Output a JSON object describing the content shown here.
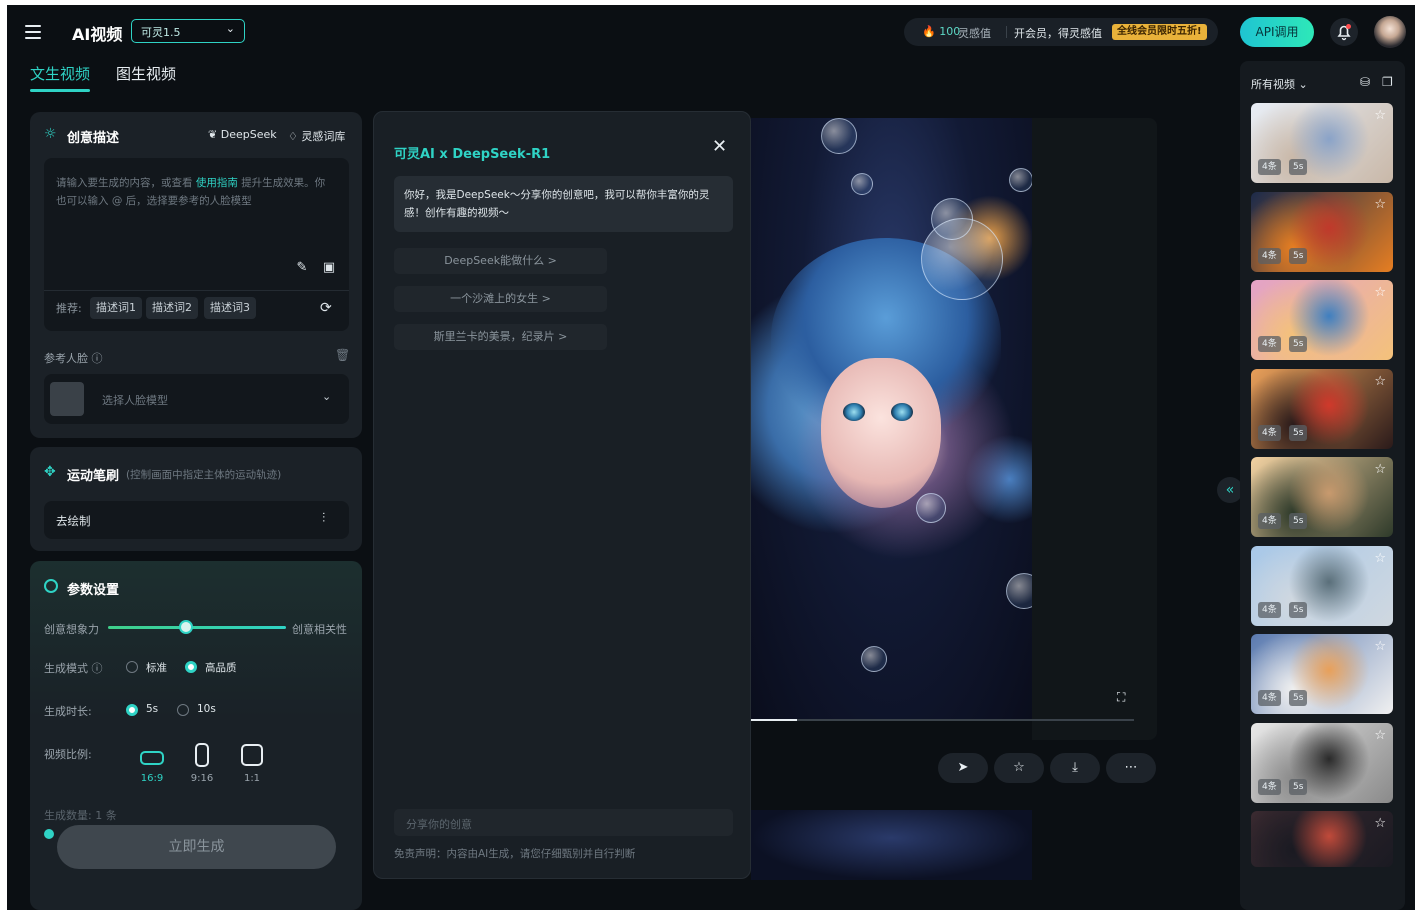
{
  "header": {
    "brand": "AI视频",
    "model": "可灵1.5",
    "credits_num": "100",
    "credits_unit": "灵感值",
    "vip_text": "开会员，得灵感值",
    "promo": "全线会员限时五折!",
    "api_label": "API调用"
  },
  "tabs": [
    "文生视频",
    "图生视频"
  ],
  "creative": {
    "title": "创意描述",
    "deepseek_link": "DeepSeek",
    "library_link": "灵感词库",
    "placeholder_a": "请输入要生成的内容，或查看",
    "placeholder_guide": "使用指南",
    "placeholder_b": "提升生成效果。你也可以输入 @ 后，选择要参考的人脸模型",
    "rec_label": "推荐:",
    "chips": [
      "描述词1",
      "描述词2",
      "描述词3"
    ],
    "face_label": "参考人脸",
    "face_placeholder": "选择人脸模型"
  },
  "motion": {
    "title": "运动笔刷",
    "subtitle": "(控制画面中指定主体的运动轨迹)",
    "draw_label": "去绘制"
  },
  "params": {
    "title": "参数设置",
    "slider_left": "创意想象力",
    "slider_right": "创意相关性",
    "slider_value": 0.44,
    "mode_label": "生成模式",
    "mode_options": [
      "标准",
      "高品质"
    ],
    "mode_selected": "高品质",
    "duration_label": "生成时长:",
    "duration_options": [
      "5s",
      "10s"
    ],
    "duration_selected": "5s",
    "ratio_label": "视频比例:",
    "ratios": [
      "16:9",
      "9:16",
      "1:1"
    ],
    "ratio_selected": "16:9",
    "count_label": "生成数量: 1 条",
    "generate_label": "立即生成"
  },
  "chat": {
    "title": "可灵AI x DeepSeek-R1",
    "greeting": "你好，我是DeepSeek～分享你的创意吧，我可以帮你丰富你的灵感！创作有趣的视频～",
    "suggestions": [
      "DeepSeek能做什么 >",
      "一个沙滩上的女生 >",
      "斯里兰卡的美景，纪录片 >"
    ],
    "input_placeholder": "分享你的创意",
    "disclaimer": "免责声明：内容由AI生成，请您仔细甄别并自行判断"
  },
  "player": {
    "progress": 0.12
  },
  "sidebar": {
    "title": "所有视频",
    "items": [
      {
        "count": "4条",
        "duration": "5s",
        "colors": [
          "#e8eef6",
          "#8aa3c8",
          "#c9b8a8"
        ]
      },
      {
        "count": "4条",
        "duration": "5s",
        "colors": [
          "#1b2a4a",
          "#c0392b",
          "#e67e22"
        ]
      },
      {
        "count": "4条",
        "duration": "5s",
        "colors": [
          "#e3a2c8",
          "#3f7fc0",
          "#f4c27a"
        ]
      },
      {
        "count": "4条",
        "duration": "5s",
        "colors": [
          "#e9a05a",
          "#d0392b",
          "#2a1a1a"
        ]
      },
      {
        "count": "4条",
        "duration": "5s",
        "colors": [
          "#f3d2a2",
          "#c89a6e",
          "#2e3a2a"
        ]
      },
      {
        "count": "4条",
        "duration": "5s",
        "colors": [
          "#a8c8e8",
          "#5a6f7a",
          "#d0d8e0"
        ]
      },
      {
        "count": "4条",
        "duration": "5s",
        "colors": [
          "#5a7ab0",
          "#e8a05a",
          "#f0f0f0"
        ]
      },
      {
        "count": "4条",
        "duration": "5s",
        "colors": [
          "#e8e8e8",
          "#2a2a2a",
          "#8a8a8a"
        ]
      },
      {
        "count": "",
        "duration": "",
        "colors": [
          "#3a2a30",
          "#c04a3a",
          "#1a1a22"
        ]
      }
    ]
  }
}
